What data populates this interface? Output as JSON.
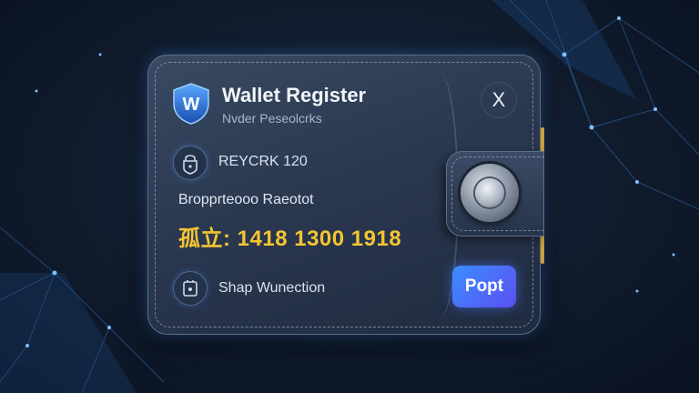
{
  "dialog": {
    "title": "Wallet Register",
    "subtitle": "Nvder Peseolcrks",
    "shield_letter": "W",
    "close_label": "X"
  },
  "rows": {
    "lock_row_text": "REYCRK 120",
    "balance_label": "Bropprteooo Raeotot",
    "amount": "孤立: 1418  1300  1918",
    "action_row_text": "Shap Wunection"
  },
  "action_button": {
    "label": "Popt"
  },
  "colors": {
    "accent_blue": "#3c8dff",
    "amount_gold": "#f4c531",
    "card_bg": "#2a3850"
  }
}
